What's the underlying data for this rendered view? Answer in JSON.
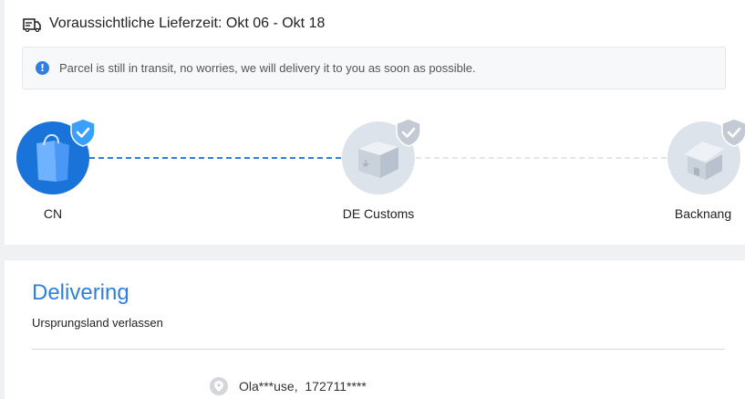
{
  "delivery": {
    "eta_text": "Voraussichtliche Lieferzeit: Okt 06 - Okt 18"
  },
  "notice": {
    "message": "Parcel is still in transit, no worries, we will delivery it to you as soon as possible."
  },
  "tracking": {
    "nodes": [
      {
        "label": "CN",
        "state": "active",
        "icon": "shopping-bag-icon"
      },
      {
        "label": "DE Customs",
        "state": "pending",
        "icon": "package-box-icon"
      },
      {
        "label": "Backnang",
        "state": "pending",
        "icon": "house-icon"
      }
    ],
    "colors": {
      "active": "#1a73d9",
      "pending": "#dde3ea",
      "accent": "#2f7fe0"
    }
  },
  "status": {
    "title": "Delivering",
    "subtitle": "Ursprungsland verlassen"
  },
  "address": {
    "text": "Ola***use,  172711****"
  }
}
